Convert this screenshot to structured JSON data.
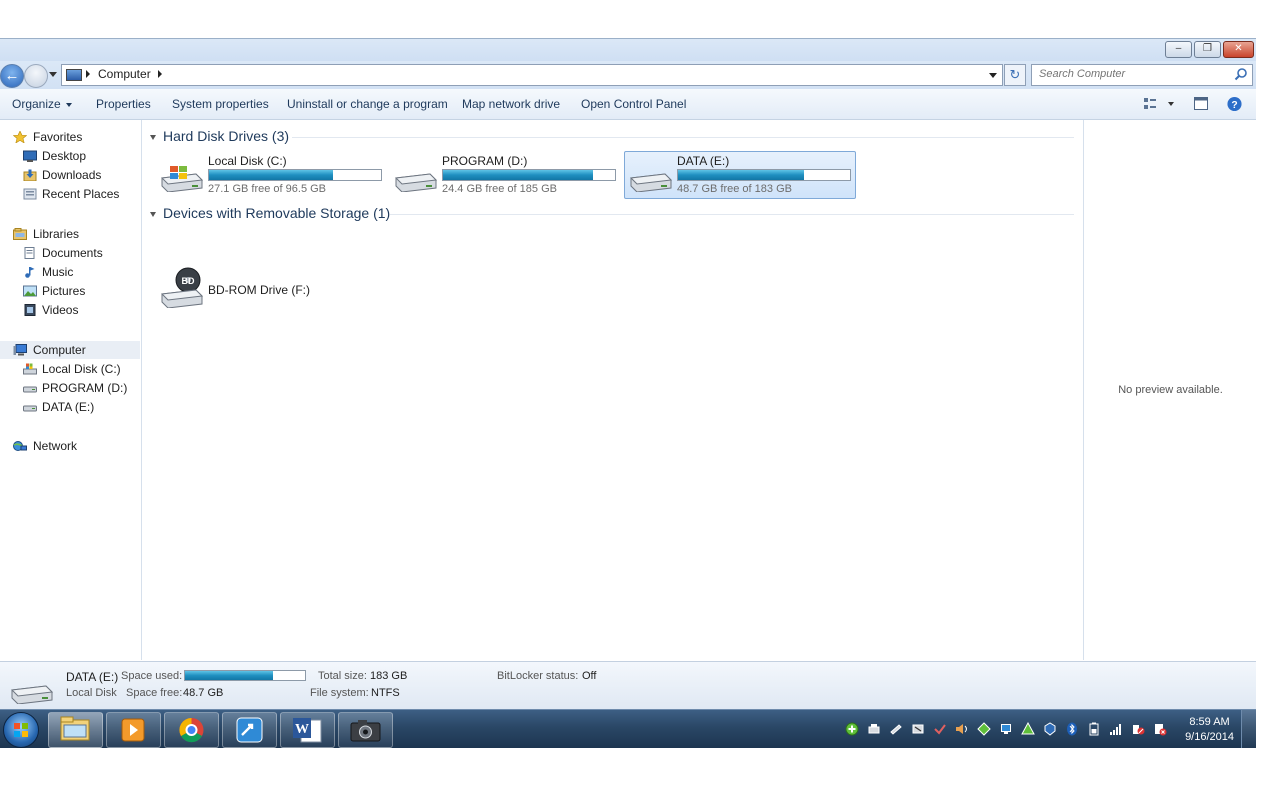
{
  "window": {
    "minimize_glyph": "–",
    "maximize_glyph": "❐",
    "close_glyph": "✕"
  },
  "address": {
    "crumbs": [
      "Computer"
    ],
    "search_placeholder": "Search Computer"
  },
  "toolbar": {
    "items": [
      "Organize",
      "Properties",
      "System properties",
      "Uninstall or change a program",
      "Map network drive",
      "Open Control Panel"
    ]
  },
  "navigation": {
    "favorites": {
      "label": "Favorites",
      "items": [
        "Desktop",
        "Downloads",
        "Recent Places"
      ]
    },
    "libraries": {
      "label": "Libraries",
      "items": [
        "Documents",
        "Music",
        "Pictures",
        "Videos"
      ]
    },
    "computer": {
      "label": "Computer",
      "items": [
        "Local Disk (C:)",
        "PROGRAM (D:)",
        "DATA (E:)"
      ]
    },
    "network": {
      "label": "Network"
    }
  },
  "groups": {
    "hard_disks": {
      "title": "Hard Disk Drives (3)",
      "drives": [
        {
          "name": "Local Disk (C:)",
          "free_text": "27.1 GB free of 96.5 GB",
          "used_fraction": 0.72
        },
        {
          "name": "PROGRAM (D:)",
          "free_text": "24.4 GB free of 185 GB",
          "used_fraction": 0.87
        },
        {
          "name": "DATA (E:)",
          "free_text": "48.7 GB free of 183 GB",
          "used_fraction": 0.73
        }
      ]
    },
    "removable": {
      "title": "Devices with Removable Storage (1)",
      "devices": [
        {
          "name": "BD-ROM Drive (F:)"
        }
      ]
    }
  },
  "preview": {
    "message": "No preview available."
  },
  "details": {
    "name": "DATA (E:)",
    "type": "Local Disk",
    "space_used_label": "Space used:",
    "space_used_fraction": 0.73,
    "space_free_label": "Space free:",
    "space_free_value": "48.7 GB",
    "total_size_label": "Total size:",
    "total_size_value": "183 GB",
    "file_system_label": "File system:",
    "file_system_value": "NTFS",
    "bitlocker_label": "BitLocker status:",
    "bitlocker_value": "Off"
  },
  "taskbar": {
    "time": "8:59 AM",
    "date": "9/16/2014",
    "pinned": [
      "windows-explorer",
      "media-player",
      "google-chrome",
      "remote-app",
      "microsoft-word",
      "camera-app"
    ]
  },
  "colors": {
    "accent": "#1e395b",
    "bar_fill": "#1f8fc0",
    "taskbar": "#2a4766"
  }
}
